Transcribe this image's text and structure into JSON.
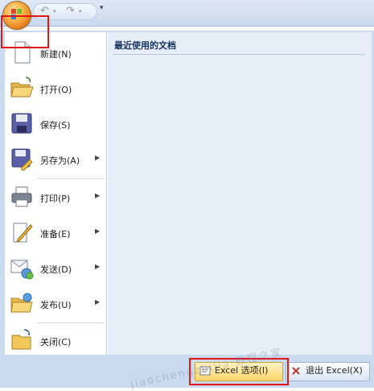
{
  "menu": {
    "items": [
      {
        "label": "新建(N)",
        "icon": "new-document-icon",
        "submenu": false
      },
      {
        "label": "打开(O)",
        "icon": "folder-open-icon",
        "submenu": false
      },
      {
        "label": "保存(S)",
        "icon": "save-icon",
        "submenu": false
      },
      {
        "label": "另存为(A)",
        "icon": "save-as-icon",
        "submenu": true
      },
      {
        "label": "打印(P)",
        "icon": "printer-icon",
        "submenu": true
      },
      {
        "label": "准备(E)",
        "icon": "prepare-icon",
        "submenu": true
      },
      {
        "label": "发送(D)",
        "icon": "send-icon",
        "submenu": true
      },
      {
        "label": "发布(U)",
        "icon": "publish-icon",
        "submenu": true
      },
      {
        "label": "关闭(C)",
        "icon": "close-folder-icon",
        "submenu": false
      }
    ],
    "submenu_glyph": "▶"
  },
  "recent": {
    "title": "最近使用的文档"
  },
  "footer": {
    "options_label": "Excel 选项(I)",
    "exit_label": "退出 Excel(X)"
  },
  "quick_access": {
    "undo_icon": "↶",
    "redo_icon": "↷",
    "dropdown_icon": "▾",
    "customize_icon": "▾"
  },
  "colors": {
    "highlight_box": "#e2161a",
    "menu_background": "#c9d9ee"
  },
  "watermark": "jiaochengzhijia 教程之家"
}
